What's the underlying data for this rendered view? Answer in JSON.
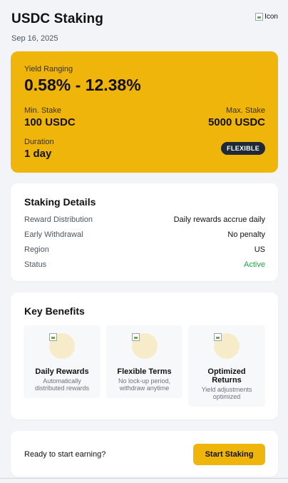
{
  "header": {
    "title": "USDC Staking",
    "date": "Sep 16, 2025",
    "icon_alt": "Icon"
  },
  "yield_card": {
    "label": "Yield Ranging",
    "range": "0.58% - 12.38%",
    "min_label": "Min. Stake",
    "min_value": "100 USDC",
    "max_label": "Max. Stake",
    "max_value": "5000 USDC",
    "duration_label": "Duration",
    "duration_value": "1 day",
    "badge": "FLEXIBLE"
  },
  "details": {
    "title": "Staking Details",
    "rows": [
      {
        "key": "Reward Distribution",
        "value": "Daily rewards accrue daily"
      },
      {
        "key": "Early Withdrawal",
        "value": "No penalty"
      },
      {
        "key": "Region",
        "value": "US"
      },
      {
        "key": "Status",
        "value": "Active"
      }
    ]
  },
  "benefits": {
    "title": "Key Benefits",
    "items": [
      {
        "name": "Daily Rewards",
        "desc": "Automatically distributed rewards"
      },
      {
        "name": "Flexible Terms",
        "desc": "No lock-up period, withdraw anytime"
      },
      {
        "name": "Optimized Returns",
        "desc": "Yield adjustments optimized"
      }
    ]
  },
  "cta": {
    "text": "Ready to start earning?",
    "button": "Start Staking"
  },
  "colors": {
    "accent": "#f0b50b",
    "badge_bg": "#1f2937",
    "status_active": "#22a447"
  }
}
